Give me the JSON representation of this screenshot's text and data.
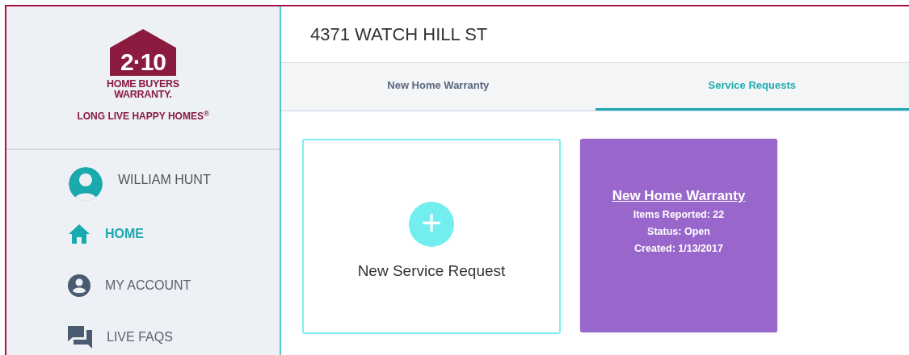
{
  "logo": {
    "mark": "2·10",
    "name_line1": "HOME BUYERS",
    "name_line2": "WARRANTY.",
    "tagline": "LONG LIVE HAPPY HOMES$^{®}$"
  },
  "user": {
    "name": "WILLIAM HUNT"
  },
  "nav": [
    {
      "label": "HOME",
      "selected": true
    },
    {
      "label": "MY ACCOUNT",
      "selected": false
    },
    {
      "label": "LIVE FAQS",
      "selected": false
    }
  ],
  "header": {
    "title": "4371 WATCH HILL ST"
  },
  "tabs": [
    {
      "label": "New Home Warranty",
      "selected": false
    },
    {
      "label": "Service Requests",
      "selected": true
    }
  ],
  "cards": [
    {
      "kind": "new",
      "label": "New Service Request",
      "icon_text": "+"
    },
    {
      "kind": "request",
      "title": "New Home Warranty",
      "lines": [
        "Items Reported: 22",
        "Status: Open",
        "Created: 1/13/2017"
      ]
    }
  ]
}
